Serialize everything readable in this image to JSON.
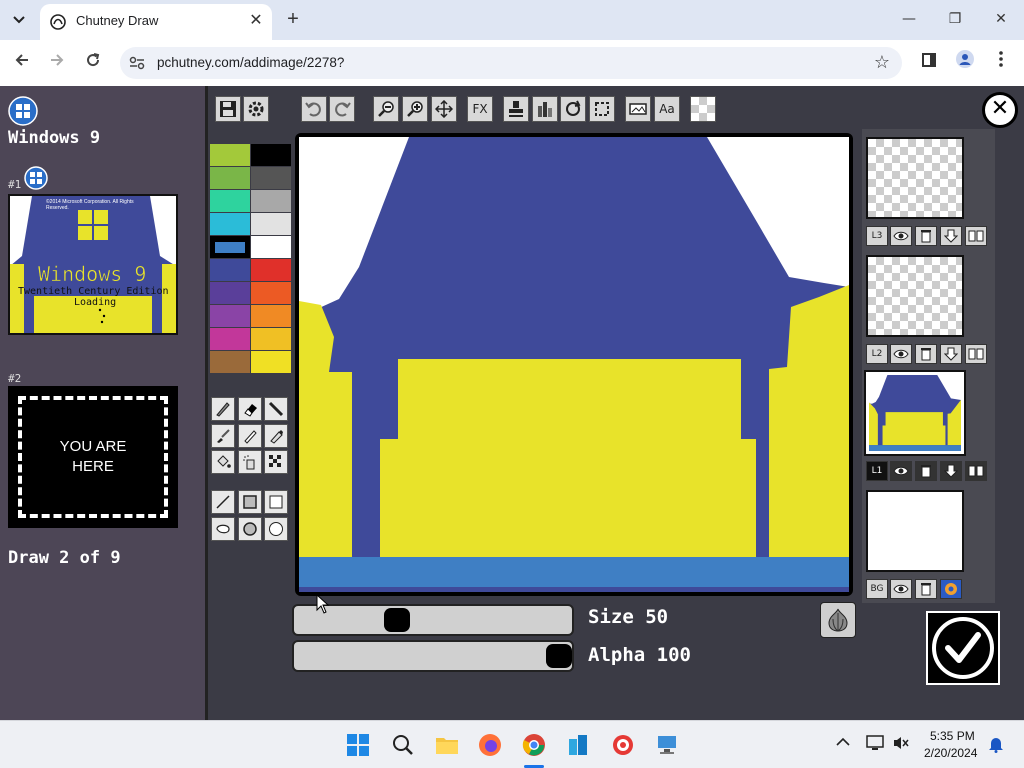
{
  "browser": {
    "tab_title": "Chutney Draw",
    "tab_close": "✕",
    "new_tab": "+",
    "url": "pchutney.com/addimage/2278?",
    "window_minimize": "—",
    "window_restore": "❐",
    "window_close": "✕"
  },
  "sidebar": {
    "app_name": "Windows 9",
    "draw1_label": "#1",
    "draw1_thumb_title": "Windows 9",
    "draw1_thumb_subtitle": "Twentieth Century Edition",
    "draw1_thumb_loading": "Loading",
    "draw1_thumb_copyright": "©2014 Microsoft Corporation. All Rights Reserved.",
    "draw2_label": "#2",
    "draw2_text_line1": "YOU ARE",
    "draw2_text_line2": "HERE",
    "progress": "Draw 2 of 9"
  },
  "toolbar": {
    "fx": "FX",
    "text_tool": "Aa"
  },
  "palette": {
    "colors": [
      "#a3c93a",
      "#000000",
      "#7ab648",
      "#555555",
      "#2ed39e",
      "#a8a8a8",
      "#2bbcd8",
      "#e2e2e2",
      "#3f7fc4",
      "#ffffff",
      "#3f4a9a",
      "#e0302a",
      "#5a3f9a",
      "#ec5a24",
      "#8a44a6",
      "#f08a24",
      "#c2379a",
      "#f0c024",
      "#9a6a3a",
      "#f0e024"
    ],
    "selected": "#3f7fc4"
  },
  "canvas": {
    "bg": "#3f4a9a",
    "yellow": "#e8e32a",
    "bar_blue": "#3f7fc4"
  },
  "sliders": {
    "size_label": "Size 50",
    "size_value": 50,
    "alpha_label": "Alpha 100",
    "alpha_value": 100
  },
  "layers": [
    {
      "name": "L3"
    },
    {
      "name": "L2"
    },
    {
      "name": "L1"
    },
    {
      "name": "BG"
    }
  ],
  "taskbar": {
    "time": "5:35 PM",
    "date": "2/20/2024"
  }
}
